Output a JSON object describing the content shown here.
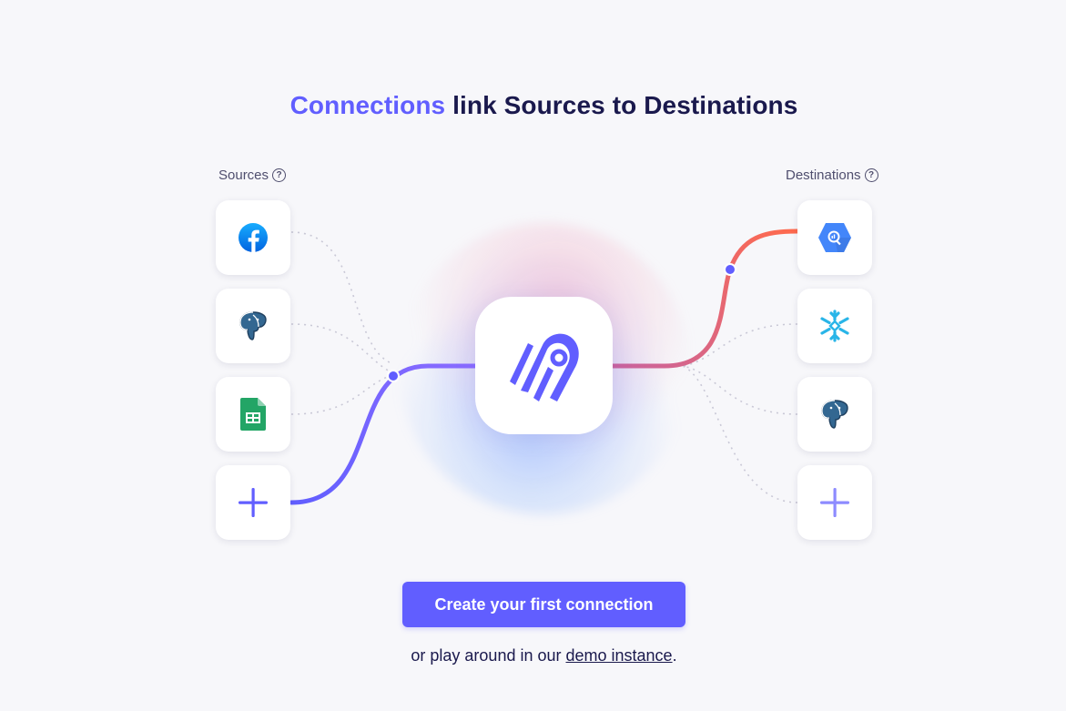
{
  "headline": {
    "accent": "Connections",
    "rest": " link Sources to Destinations"
  },
  "sources": {
    "label": "Sources",
    "items": [
      {
        "name": "facebook",
        "icon": "facebook-icon"
      },
      {
        "name": "postgres",
        "icon": "postgres-icon"
      },
      {
        "name": "google-sheets",
        "icon": "google-sheets-icon"
      },
      {
        "name": "add",
        "icon": "plus-icon"
      }
    ]
  },
  "destinations": {
    "label": "Destinations",
    "items": [
      {
        "name": "bigquery",
        "icon": "bigquery-icon"
      },
      {
        "name": "snowflake",
        "icon": "snowflake-icon"
      },
      {
        "name": "postgres",
        "icon": "postgres-icon"
      },
      {
        "name": "add",
        "icon": "plus-icon"
      }
    ]
  },
  "help_glyph": "?",
  "center": {
    "icon": "airbyte-logo-icon"
  },
  "cta": {
    "label": "Create your first connection"
  },
  "footer": {
    "prefix": "or play around in our ",
    "link": "demo instance",
    "suffix": "."
  },
  "colors": {
    "accent": "#615eff",
    "heading": "#1a194d",
    "dest_line_start": "#ff6a4d",
    "dest_line_end": "#c864a0"
  }
}
